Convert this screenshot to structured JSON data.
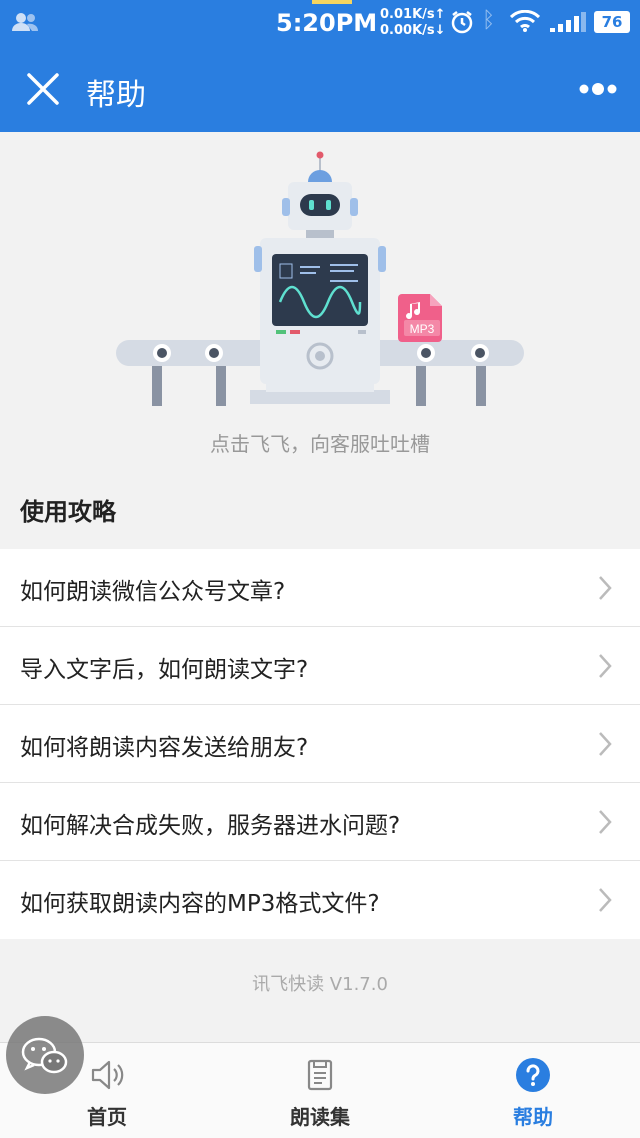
{
  "status_bar": {
    "time": "5:20PM",
    "net_up": "0.01K/s↑",
    "net_down": "0.00K/s↓",
    "battery": "76"
  },
  "navbar": {
    "title": "帮助"
  },
  "hero": {
    "caption": "点击飞飞，向客服吐吐槽",
    "badge": "MP3"
  },
  "guide": {
    "title": "使用攻略",
    "items": [
      {
        "label": "如何朗读微信公众号文章?"
      },
      {
        "label": "导入文字后，如何朗读文字?"
      },
      {
        "label": "如何将朗读内容发送给朋友?"
      },
      {
        "label": "如何解决合成失败，服务器进水问题?"
      },
      {
        "label": "如何获取朗读内容的MP3格式文件?"
      }
    ]
  },
  "version": "讯飞快读 V1.7.0",
  "tabs": [
    {
      "label": "首页",
      "icon": "speaker-icon"
    },
    {
      "label": "朗读集",
      "icon": "book-icon"
    },
    {
      "label": "帮助",
      "icon": "help-icon"
    }
  ],
  "colors": {
    "brand": "#2a7ee0",
    "background": "#f2f2f2"
  }
}
